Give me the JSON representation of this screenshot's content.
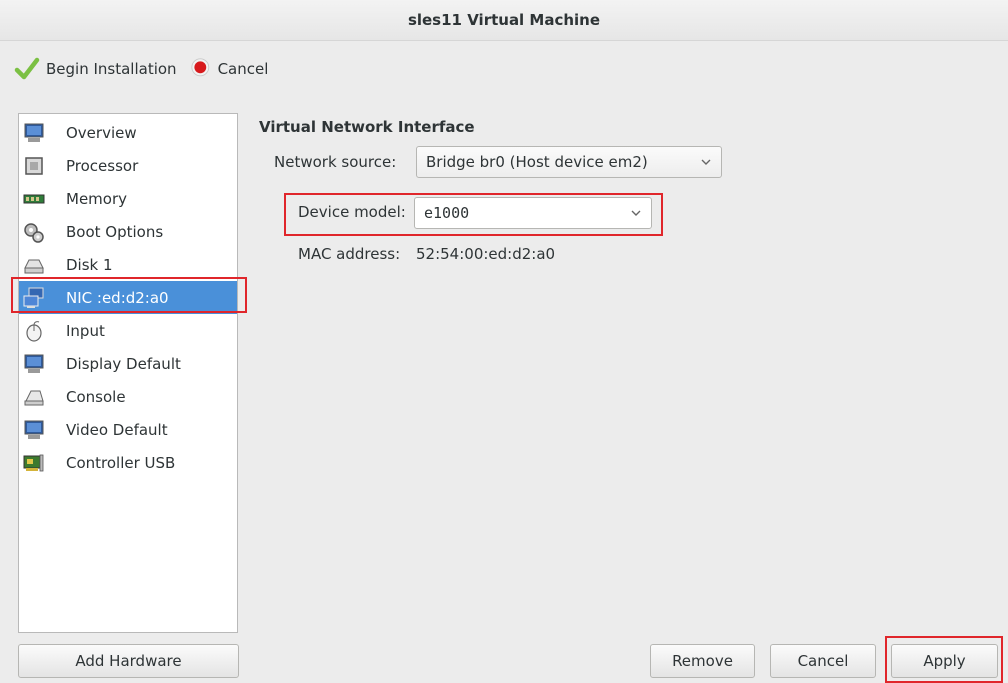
{
  "window": {
    "title": "sles11 Virtual Machine"
  },
  "toolbar": {
    "begin_label": "Begin Installation",
    "begin_icon": "checkmark-icon",
    "cancel_label": "Cancel",
    "cancel_icon": "stop-icon"
  },
  "sidebar": {
    "items": [
      {
        "label": "Overview",
        "icon": "monitor-icon"
      },
      {
        "label": "Processor",
        "icon": "cpu-icon"
      },
      {
        "label": "Memory",
        "icon": "memory-icon"
      },
      {
        "label": "Boot Options",
        "icon": "gears-icon"
      },
      {
        "label": "Disk 1",
        "icon": "disk-icon"
      },
      {
        "label": "NIC :ed:d2:a0",
        "icon": "network-icon",
        "selected": true
      },
      {
        "label": "Input",
        "icon": "mouse-icon"
      },
      {
        "label": "Display Default",
        "icon": "monitor-icon"
      },
      {
        "label": "Console",
        "icon": "console-icon"
      },
      {
        "label": "Video Default",
        "icon": "monitor-icon"
      },
      {
        "label": "Controller USB",
        "icon": "controller-card-icon"
      }
    ],
    "add_hardware_label": "Add Hardware"
  },
  "details": {
    "title": "Virtual Network Interface",
    "network_source_label": "Network source:",
    "network_source_value": "Bridge br0 (Host device em2)",
    "device_model_label": "Device model:",
    "device_model_value": "e1000",
    "mac_label": "MAC address:",
    "mac_value": "52:54:00:ed:d2:a0"
  },
  "buttons": {
    "remove": "Remove",
    "cancel": "Cancel",
    "apply": "Apply"
  },
  "colors": {
    "highlight": "#e0262b",
    "selection": "#4a90d9"
  }
}
